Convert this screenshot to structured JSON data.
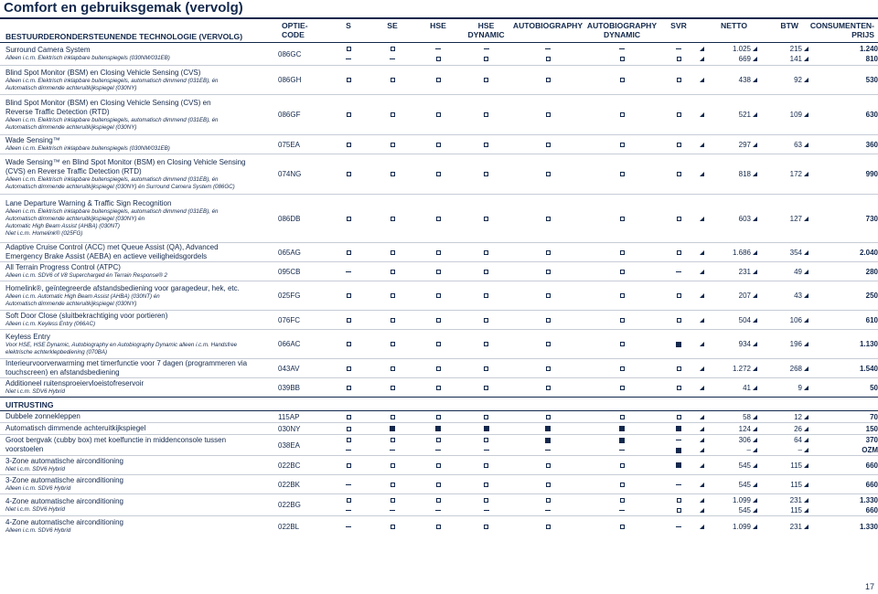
{
  "title": "Comfort en gebruiksgemak (vervolg)",
  "page_number": "17",
  "header": {
    "section": "BESTUURDERONDERSTEUNENDE TECHNOLOGIE (VERVOLG)",
    "optie_code": "OPTIE-CODE",
    "cols": [
      "S",
      "SE",
      "HSE",
      "HSE DYNAMIC",
      "AUTOBIOGRAPHY",
      "AUTOBIOGRAPHY DYNAMIC",
      "SVR"
    ],
    "netto": "NETTO",
    "btw": "BTW",
    "consumenten": "CONSUMENTEN-PRIJS"
  },
  "rows1": [
    {
      "lines": [
        "Surround Camera System"
      ],
      "notes": [
        "Alleen i.c.m. Elektrisch inklapbare buitenspiegels (030NM/031EB)"
      ],
      "code": "086GC",
      "opts": [
        [
          "o",
          "o",
          "-",
          "-",
          "-",
          "-",
          "-"
        ],
        [
          "-",
          "-",
          "o",
          "o",
          "o",
          "o",
          "o"
        ]
      ],
      "netto": [
        "1.025",
        "669"
      ],
      "btw": [
        "215",
        "141"
      ],
      "prijs": [
        "1.240",
        "810"
      ]
    },
    {
      "lines": [
        "Blind Spot Monitor (BSM) en Closing Vehicle Sensing (CVS)"
      ],
      "notes": [
        "Alleen i.c.m. Elektrisch inklapbare buitenspiegels, automatisch dimmend (031EB), én",
        "Automatisch dimmende achteruitkijkspiegel (030NY)"
      ],
      "code": "086GH",
      "opts": [
        [
          "o",
          "o",
          "o",
          "o",
          "o",
          "o",
          "o"
        ]
      ],
      "netto": [
        "438"
      ],
      "btw": [
        "92"
      ],
      "prijs": [
        "530"
      ]
    },
    {
      "lines": [
        "Blind Spot Monitor (BSM) en Closing Vehicle Sensing (CVS) en",
        "Reverse Traffic Detection (RTD)"
      ],
      "notes": [
        "Alleen i.c.m. Elektrisch inklapbare buitenspiegels, automatisch dimmend (031EB), én",
        "Automatisch dimmende achteruitkijkspiegel (030NY)"
      ],
      "code": "086GF",
      "opts": [
        [
          "o",
          "o",
          "o",
          "o",
          "o",
          "o",
          "o"
        ]
      ],
      "netto": [
        "521"
      ],
      "btw": [
        "109"
      ],
      "prijs": [
        "630"
      ]
    },
    {
      "lines": [
        "Wade Sensing™"
      ],
      "notes": [
        "Alleen i.c.m. Elektrisch inklapbare buitenspiegels (030NM/031EB)"
      ],
      "code": "075EA",
      "opts": [
        [
          "o",
          "o",
          "o",
          "o",
          "o",
          "o",
          "o"
        ]
      ],
      "netto": [
        "297"
      ],
      "btw": [
        "63"
      ],
      "prijs": [
        "360"
      ]
    },
    {
      "lines": [
        "Wade Sensing™ en Blind Spot Monitor (BSM) en Closing Vehicle Sensing",
        "(CVS) en Reverse Traffic Detection (RTD)"
      ],
      "notes": [
        "Alleen i.c.m. Elektrisch inklapbare buitenspiegels, automatisch dimmend (031EB), én",
        "Automatisch dimmende achteruitkijkspiegel (030NY) én Surround Camera System (086GC)"
      ],
      "code": "074NG",
      "opts": [
        [
          "o",
          "o",
          "o",
          "o",
          "o",
          "o",
          "o"
        ]
      ],
      "netto": [
        "818"
      ],
      "btw": [
        "172"
      ],
      "prijs": [
        "990"
      ]
    },
    {
      "lines": [
        "Lane Departure Warning & Traffic Sign Recognition"
      ],
      "notes": [
        "Alleen i.c.m. Elektrisch inklapbare buitenspiegels, automatisch dimmend (031EB), én",
        "Automatisch dimmende achteruitkijkspiegel (030NY) én",
        "Automatic High Beam Assist (AHBA) (030NT)",
        "Niet i.c.m. Homelink® (025FG)"
      ],
      "code": "086DB",
      "opts": [
        [
          "o",
          "o",
          "o",
          "o",
          "o",
          "o",
          "o"
        ]
      ],
      "netto": [
        "603"
      ],
      "btw": [
        "127"
      ],
      "prijs": [
        "730"
      ]
    },
    {
      "lines": [
        "Adaptive Cruise Control (ACC) met Queue Assist (QA), Advanced",
        "Emergency Brake Assist (AEBA) en actieve veiligheidsgordels"
      ],
      "notes": [],
      "code": "065AG",
      "opts": [
        [
          "o",
          "o",
          "o",
          "o",
          "o",
          "o",
          "o"
        ]
      ],
      "netto": [
        "1.686"
      ],
      "btw": [
        "354"
      ],
      "prijs": [
        "2.040"
      ]
    },
    {
      "lines": [
        "All Terrain Progress Control (ATPC)"
      ],
      "notes": [
        "Alleen i.c.m. SDV6 of V8 Supercharged én Terrain Response® 2"
      ],
      "code": "095CB",
      "opts": [
        [
          "-",
          "o",
          "o",
          "o",
          "o",
          "o",
          "-"
        ]
      ],
      "netto": [
        "231"
      ],
      "btw": [
        "49"
      ],
      "prijs": [
        "280"
      ]
    },
    {
      "lines": [
        "Homelink®, geïntegreerde afstandsbediening voor garagedeur, hek, etc."
      ],
      "notes": [
        "Alleen i.c.m. Automatic High Beam Assist (AHBA) (030NT) én",
        "Automatisch dimmende achteruitkijkspiegel (030NY)"
      ],
      "code": "025FG",
      "opts": [
        [
          "o",
          "o",
          "o",
          "o",
          "o",
          "o",
          "o"
        ]
      ],
      "netto": [
        "207"
      ],
      "btw": [
        "43"
      ],
      "prijs": [
        "250"
      ]
    },
    {
      "lines": [
        "Soft Door Close (sluitbekrachtiging voor portieren)"
      ],
      "notes": [
        "Alleen i.c.m. Keyless Entry (066AC)"
      ],
      "code": "076FC",
      "opts": [
        [
          "o",
          "o",
          "o",
          "o",
          "o",
          "o",
          "o"
        ]
      ],
      "netto": [
        "504"
      ],
      "btw": [
        "106"
      ],
      "prijs": [
        "610"
      ]
    },
    {
      "lines": [
        "Keyless Entry"
      ],
      "notes": [
        "Voor HSE, HSE Dynamic, Autobiography en Autobiography Dynamic alleen i.c.m. Handsfree",
        "elektrische achterklepbediening (070BA)"
      ],
      "code": "066AC",
      "opts": [
        [
          "o",
          "o",
          "o",
          "o",
          "o",
          "o",
          "f"
        ]
      ],
      "netto": [
        "934"
      ],
      "btw": [
        "196"
      ],
      "prijs": [
        "1.130"
      ]
    },
    {
      "lines": [
        "Interieurvoorverwarming met timerfunctie voor 7 dagen (programmeren via",
        "touchscreen) en afstandsbediening"
      ],
      "notes": [],
      "code": "043AV",
      "opts": [
        [
          "o",
          "o",
          "o",
          "o",
          "o",
          "o",
          "o"
        ]
      ],
      "netto": [
        "1.272"
      ],
      "btw": [
        "268"
      ],
      "prijs": [
        "1.540"
      ]
    },
    {
      "lines": [
        "Additioneel ruitensproeiervloeistofreservoir"
      ],
      "notes": [
        "Niet i.c.m. SDV6 Hybrid"
      ],
      "code": "039BB",
      "opts": [
        [
          "o",
          "o",
          "o",
          "o",
          "o",
          "o",
          "o"
        ]
      ],
      "netto": [
        "41"
      ],
      "btw": [
        "9"
      ],
      "prijs": [
        "50"
      ]
    }
  ],
  "section2": "UITRUSTING",
  "rows2": [
    {
      "lines": [
        "Dubbele zonnekleppen"
      ],
      "notes": [],
      "code": "115AP",
      "opts": [
        [
          "o",
          "o",
          "o",
          "o",
          "o",
          "o",
          "o"
        ]
      ],
      "netto": [
        "58"
      ],
      "btw": [
        "12"
      ],
      "prijs": [
        "70"
      ]
    },
    {
      "lines": [
        "Automatisch dimmende achteruitkijkspiegel"
      ],
      "notes": [],
      "code": "030NY",
      "opts": [
        [
          "o",
          "f",
          "f",
          "f",
          "f",
          "f",
          "f"
        ]
      ],
      "netto": [
        "124"
      ],
      "btw": [
        "26"
      ],
      "prijs": [
        "150"
      ]
    },
    {
      "lines": [
        "Groot bergvak (cubby box) met koelfunctie in middenconsole tussen",
        "voorstoelen"
      ],
      "notes": [],
      "code": "038EA",
      "opts": [
        [
          "o",
          "o",
          "o",
          "o",
          "f",
          "f",
          "-"
        ],
        [
          "-",
          "-",
          "-",
          "-",
          "-",
          "-",
          "f"
        ]
      ],
      "netto": [
        "306",
        "–"
      ],
      "btw": [
        "64",
        "–"
      ],
      "prijs": [
        "370",
        "OZM"
      ]
    },
    {
      "lines": [
        "3-Zone automatische airconditioning"
      ],
      "notes": [
        "Niet i.c.m. SDV6 Hybrid"
      ],
      "code": "022BC",
      "opts": [
        [
          "o",
          "o",
          "o",
          "o",
          "o",
          "o",
          "f"
        ]
      ],
      "netto": [
        "545"
      ],
      "btw": [
        "115"
      ],
      "prijs": [
        "660"
      ]
    },
    {
      "lines": [
        "3-Zone automatische airconditioning"
      ],
      "notes": [
        "Alleen i.c.m. SDV6 Hybrid"
      ],
      "code": "022BK",
      "opts": [
        [
          "-",
          "o",
          "o",
          "o",
          "o",
          "o",
          "-"
        ]
      ],
      "netto": [
        "545"
      ],
      "btw": [
        "115"
      ],
      "prijs": [
        "660"
      ]
    },
    {
      "lines": [
        "4-Zone automatische airconditioning"
      ],
      "notes": [
        "Niet i.c.m. SDV6 Hybrid"
      ],
      "code": "022BG",
      "opts": [
        [
          "o",
          "o",
          "o",
          "o",
          "o",
          "o",
          "o"
        ],
        [
          "-",
          "-",
          "-",
          "-",
          "-",
          "-",
          "o"
        ]
      ],
      "netto": [
        "1.099",
        "545"
      ],
      "btw": [
        "231",
        "115"
      ],
      "prijs": [
        "1.330",
        "660"
      ]
    },
    {
      "lines": [
        "4-Zone automatische airconditioning"
      ],
      "notes": [
        "Alleen i.c.m. SDV6 Hybrid"
      ],
      "code": "022BL",
      "opts": [
        [
          "-",
          "o",
          "o",
          "o",
          "o",
          "o",
          "-"
        ]
      ],
      "netto": [
        "1.099"
      ],
      "btw": [
        "231"
      ],
      "prijs": [
        "1.330"
      ]
    }
  ]
}
